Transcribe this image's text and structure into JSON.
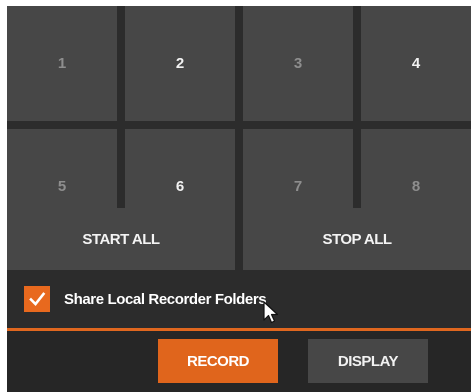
{
  "recorders": {
    "buttons": [
      {
        "label": "1",
        "active": false
      },
      {
        "label": "2",
        "active": true
      },
      {
        "label": "3",
        "active": false
      },
      {
        "label": "4",
        "active": true
      },
      {
        "label": "5",
        "active": false
      },
      {
        "label": "6",
        "active": true
      },
      {
        "label": "7",
        "active": false
      },
      {
        "label": "8",
        "active": false
      }
    ]
  },
  "controls": {
    "start_all_label": "START ALL",
    "stop_all_label": "STOP ALL"
  },
  "share": {
    "label": "Share Local Recorder Folders",
    "checked": true
  },
  "tabs": {
    "record_label": "RECORD",
    "display_label": "DISPLAY",
    "selected": "RECORD"
  },
  "colors": {
    "accent": "#e0651c",
    "button_bg": "#474747",
    "panel_bg": "#2c2c2c",
    "inactive_text": "#8e8e8e",
    "active_text": "#f2f2f2"
  },
  "icons": {
    "checkbox": "checkmark-icon",
    "pointer": "mouse-cursor-icon"
  }
}
